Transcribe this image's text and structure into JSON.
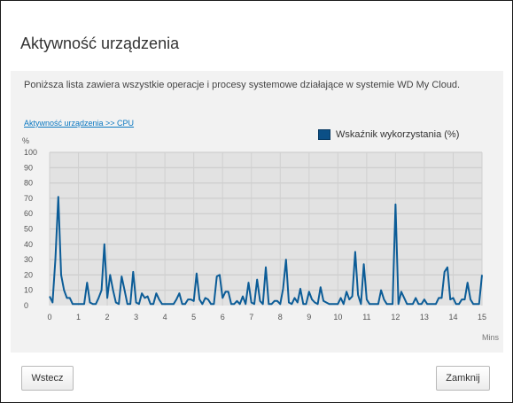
{
  "dialog": {
    "title": "Aktywność urządzenia",
    "description": "Poniższa lista zawiera wszystkie operacje i procesy systemowe działające w systemie WD My Cloud.",
    "breadcrumb_link": "Aktywność urządzenia >> CPU",
    "back_label": "Wstecz",
    "close_label": "Zamknij"
  },
  "colors": {
    "series": "#0b5c97",
    "legend_swatch": "#0b4f86",
    "plot_bg": "#e2e2e2",
    "link": "#0b78c1"
  },
  "chart_data": {
    "type": "line",
    "ylabel": "%",
    "xlabel": "Mins",
    "ylim": [
      0,
      100
    ],
    "xlim": [
      0,
      15
    ],
    "yticks": [
      "0",
      "10",
      "20",
      "30",
      "40",
      "50",
      "60",
      "70",
      "80",
      "90",
      "100"
    ],
    "xticks": [
      "0",
      "1",
      "2",
      "3",
      "4",
      "5",
      "6",
      "7",
      "8",
      "9",
      "10",
      "11",
      "12",
      "13",
      "14",
      "15"
    ],
    "grid": true,
    "legend_position": "top-right",
    "series": [
      {
        "name": "Wskaźnik wykorzystania (%)",
        "x": [
          0,
          0.1,
          0.2,
          0.3,
          0.4,
          0.5,
          0.6,
          0.7,
          0.8,
          0.9,
          1.0,
          1.1,
          1.2,
          1.3,
          1.4,
          1.5,
          1.6,
          1.7,
          1.8,
          1.9,
          2.0,
          2.1,
          2.2,
          2.3,
          2.4,
          2.5,
          2.6,
          2.7,
          2.8,
          2.9,
          3.0,
          3.1,
          3.2,
          3.3,
          3.4,
          3.5,
          3.6,
          3.7,
          3.8,
          3.9,
          4.0,
          4.1,
          4.2,
          4.3,
          4.4,
          4.5,
          4.6,
          4.7,
          4.8,
          4.9,
          5.0,
          5.1,
          5.2,
          5.3,
          5.4,
          5.5,
          5.6,
          5.7,
          5.8,
          5.9,
          6.0,
          6.1,
          6.2,
          6.3,
          6.4,
          6.5,
          6.6,
          6.7,
          6.8,
          6.9,
          7.0,
          7.1,
          7.2,
          7.3,
          7.4,
          7.5,
          7.6,
          7.7,
          7.8,
          7.9,
          8.0,
          8.1,
          8.2,
          8.3,
          8.4,
          8.5,
          8.6,
          8.7,
          8.8,
          8.9,
          9.0,
          9.1,
          9.2,
          9.3,
          9.4,
          9.5,
          9.6,
          9.7,
          9.8,
          9.9,
          10.0,
          10.1,
          10.2,
          10.3,
          10.4,
          10.5,
          10.6,
          10.7,
          10.8,
          10.9,
          11.0,
          11.1,
          11.2,
          11.3,
          11.4,
          11.5,
          11.6,
          11.7,
          11.8,
          11.9,
          12.0,
          12.1,
          12.2,
          12.3,
          12.4,
          12.5,
          12.6,
          12.7,
          12.8,
          12.9,
          13.0,
          13.1,
          13.2,
          13.3,
          13.4,
          13.5,
          13.6,
          13.7,
          13.8,
          13.9,
          14.0,
          14.1,
          14.2,
          14.3,
          14.4,
          14.5,
          14.6,
          14.7,
          14.8,
          14.9,
          15.0
        ],
        "values": [
          6,
          2,
          30,
          71,
          20,
          10,
          5,
          5,
          1,
          1,
          1,
          1,
          1,
          15,
          2,
          1,
          1,
          5,
          10,
          40,
          5,
          20,
          10,
          2,
          1,
          19,
          10,
          1,
          1,
          22,
          2,
          1,
          8,
          5,
          6,
          1,
          1,
          8,
          4,
          1,
          1,
          1,
          1,
          1,
          4,
          8,
          1,
          1,
          4,
          4,
          3,
          21,
          4,
          1,
          5,
          4,
          1,
          1,
          19,
          20,
          5,
          9,
          9,
          1,
          1,
          3,
          1,
          6,
          1,
          15,
          2,
          1,
          17,
          3,
          1,
          25,
          1,
          1,
          3,
          3,
          1,
          11,
          30,
          2,
          1,
          5,
          2,
          11,
          1,
          1,
          9,
          4,
          2,
          1,
          12,
          3,
          2,
          1,
          1,
          1,
          1,
          5,
          1,
          9,
          4,
          6,
          35,
          7,
          1,
          27,
          4,
          1,
          1,
          1,
          1,
          10,
          4,
          1,
          1,
          1,
          66,
          1,
          9,
          5,
          1,
          1,
          1,
          5,
          1,
          1,
          4,
          1,
          1,
          1,
          1,
          5,
          5,
          22,
          25,
          4,
          5,
          1,
          1,
          4,
          4,
          15,
          4,
          1,
          1,
          1,
          20
        ]
      }
    ]
  }
}
